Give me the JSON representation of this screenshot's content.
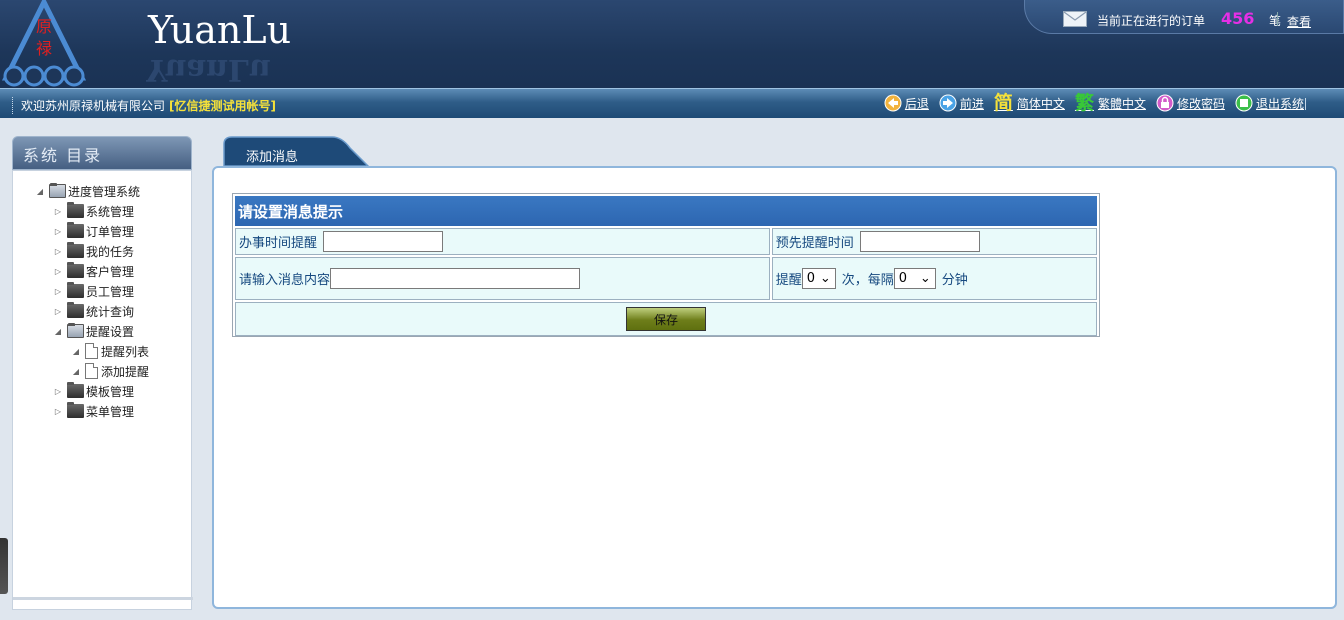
{
  "header": {
    "brand": "YuanLu",
    "brand_reflection": "YuanLu",
    "logo_chars": "原禄",
    "order_text": "当前正在进行的订单",
    "order_count": "456",
    "order_unit": "笔",
    "order_view": "查看"
  },
  "navbar": {
    "welcome": "欢迎苏州原禄机械有限公司",
    "account": "[忆信捷测试用帐号]",
    "links": [
      {
        "label": "后退",
        "icon": "back-arrow-icon"
      },
      {
        "label": "前进",
        "icon": "forward-arrow-icon"
      },
      {
        "label": "简体中文",
        "icon_char": "简",
        "icon": "simplified-chinese-icon",
        "color": "#f5e13a"
      },
      {
        "label": "繁體中文",
        "icon_char": "繁",
        "icon": "traditional-chinese-icon",
        "color": "#38c838"
      },
      {
        "label": "修改密码",
        "icon": "lock-icon"
      },
      {
        "label": "退出系统",
        "icon": "exit-icon"
      }
    ]
  },
  "sidebar": {
    "title": "系统 目录",
    "root": "进度管理系统",
    "items": [
      {
        "label": "系统管理"
      },
      {
        "label": "订单管理"
      },
      {
        "label": "我的任务"
      },
      {
        "label": "客户管理"
      },
      {
        "label": "员工管理"
      },
      {
        "label": "统计查询"
      },
      {
        "label": "提醒设置",
        "open": true,
        "children": [
          {
            "label": "提醒列表"
          },
          {
            "label": "添加提醒"
          }
        ]
      },
      {
        "label": "模板管理"
      },
      {
        "label": "菜单管理"
      }
    ]
  },
  "main": {
    "tab": "添加消息",
    "form": {
      "heading": "请设置消息提示",
      "field1_label": "办事时间提醒",
      "field2_label": "预先提醒时间",
      "field3_label": "请输入消息内容",
      "remind_label": "提醒",
      "remind_count": "0",
      "times_label": "次，每隔",
      "interval": "0",
      "minutes_label": "分钟",
      "save": "保存"
    }
  },
  "colors": {
    "header": "#1d3659",
    "form_head": "#2d66b1",
    "cell_bg": "#e9fafa",
    "accent_count": "#e52fe5"
  }
}
